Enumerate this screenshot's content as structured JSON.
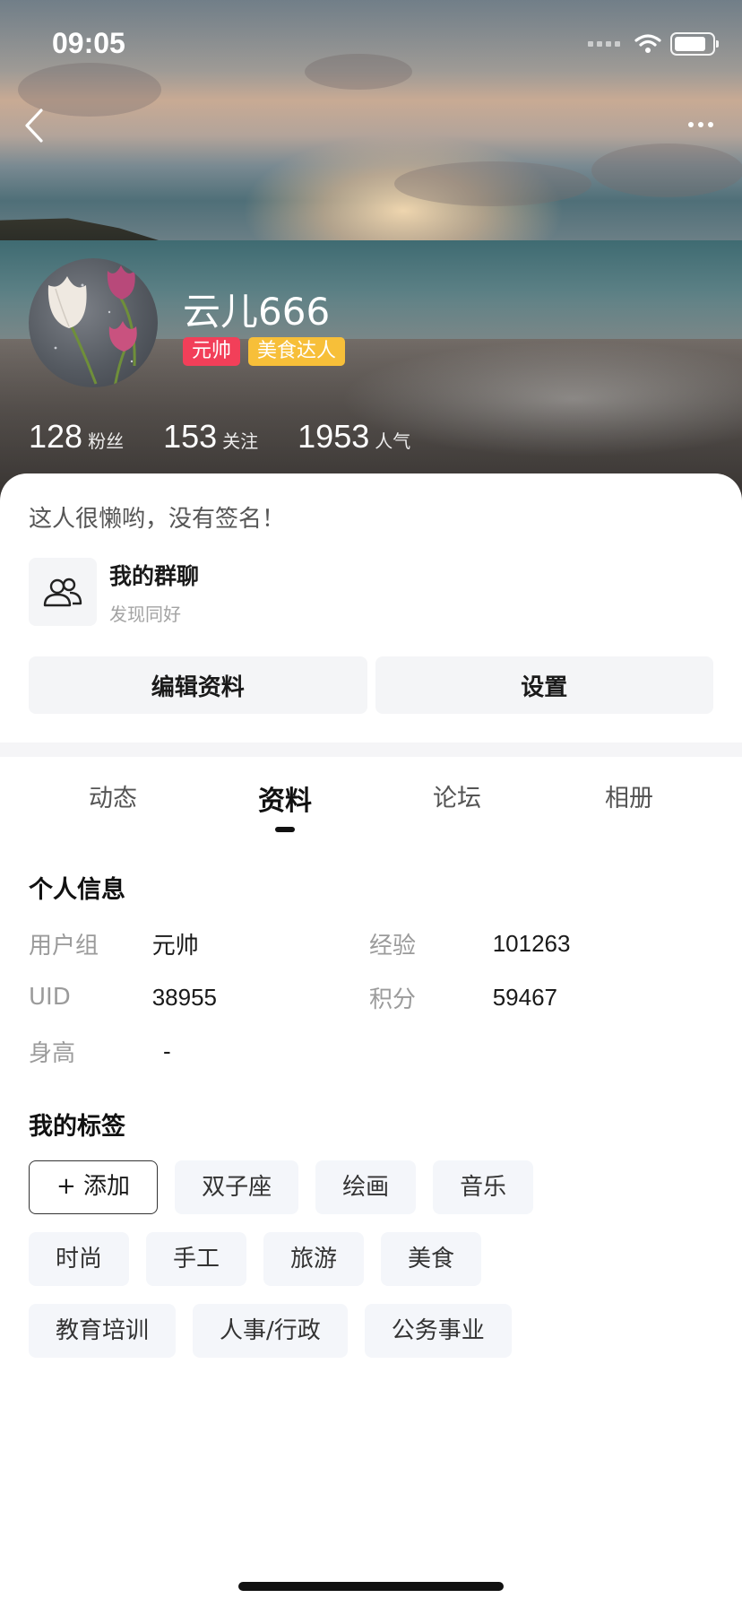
{
  "status_bar": {
    "time": "09:05",
    "battery_level": 0.85
  },
  "profile": {
    "username": "云儿666",
    "badges": [
      {
        "label": "元帅",
        "color": "#f23f59"
      },
      {
        "label": "美食达人",
        "color": "#f7bf39"
      }
    ],
    "stats": [
      {
        "value": "128",
        "label": "粉丝"
      },
      {
        "value": "153",
        "label": "关注"
      },
      {
        "value": "1953",
        "label": "人气"
      }
    ],
    "signature": "这人很懒哟，没有签名！"
  },
  "group_chat": {
    "title": "我的群聊",
    "subtitle": "发现同好",
    "icon": "group-icon"
  },
  "actions": {
    "edit_label": "编辑资料",
    "settings_label": "设置"
  },
  "tabs": [
    {
      "label": "动态",
      "active": false
    },
    {
      "label": "资料",
      "active": true
    },
    {
      "label": "论坛",
      "active": false
    },
    {
      "label": "相册",
      "active": false
    }
  ],
  "personal_info": {
    "title": "个人信息",
    "rows": [
      [
        {
          "label": "用户组",
          "value": "元帅"
        },
        {
          "label": "经验",
          "value": "101263"
        }
      ],
      [
        {
          "label": "UID",
          "value": "38955"
        },
        {
          "label": "积分",
          "value": "59467"
        }
      ],
      [
        {
          "label": "身高",
          "value": "-"
        }
      ]
    ]
  },
  "tags_section": {
    "title": "我的标签",
    "add_label": "+ 添加",
    "rows": [
      [
        "双子座",
        "绘画",
        "音乐"
      ],
      [
        "时尚",
        "手工",
        "旅游",
        "美食"
      ],
      [
        "教育培训",
        "人事/行政",
        "公务事业"
      ]
    ]
  },
  "colors": {
    "accent_red": "#f23f59",
    "accent_gold": "#f7bf39",
    "tag_bg": "#f4f6fa"
  }
}
